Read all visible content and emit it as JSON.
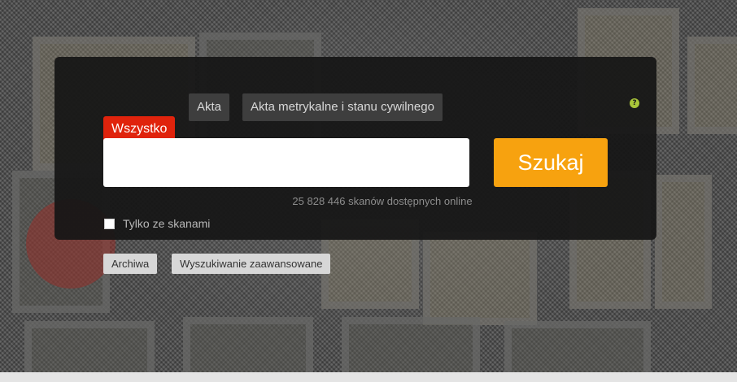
{
  "tabs": [
    {
      "label": "Akta"
    },
    {
      "label": "Akta metrykalne i stanu cywilnego"
    }
  ],
  "help": {
    "icon": "help-icon",
    "glyph": "?"
  },
  "search": {
    "category_label": "Wszystko",
    "value": "",
    "placeholder": "",
    "button_label": "Szukaj"
  },
  "scan_count_text": "25 828 446 skanów dostępnych online",
  "filter": {
    "checkbox_label": "Tylko ze skanami",
    "checked": false
  },
  "links": {
    "archives_label": "Archiwa",
    "advanced_label": "Wyszukiwanie zaawansowane"
  },
  "colors": {
    "accent": "#f7a20f",
    "category_badge": "#e0230c",
    "help_icon": "#a9c63a"
  }
}
